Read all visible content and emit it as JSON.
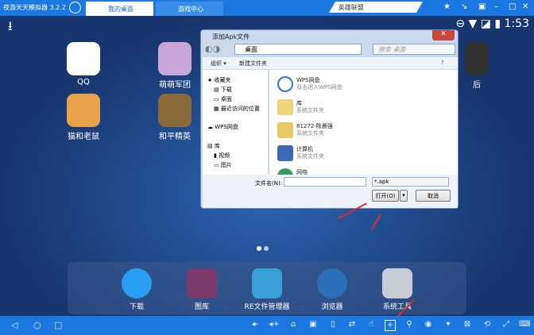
{
  "titlebar": {
    "app_name": "夜游天天模拟器 3.2.2",
    "tabs": [
      {
        "label": "我的桌面",
        "active": true
      },
      {
        "label": "游戏中心",
        "active": false
      }
    ],
    "search_value": "英雄联盟",
    "window_buttons": [
      "pin",
      "shrink",
      "restore",
      "minimize",
      "maximize",
      "close"
    ]
  },
  "statusbar": {
    "time": "1:53"
  },
  "desktop": {
    "apps": [
      {
        "label": "QQ"
      },
      {
        "label": "萌萌军团"
      },
      {
        "label": "猫和老鼠"
      },
      {
        "label": "和平精英"
      },
      {
        "label": "后"
      }
    ]
  },
  "dialog": {
    "title": "添加Apk文件",
    "close": "✕",
    "address": "桌面",
    "search_placeholder": "搜索 桌面",
    "toolbar": {
      "organize": "组织 ▾",
      "new_folder": "新建文件夹"
    },
    "nav": [
      "收藏夹",
      "下载",
      "桌面",
      "最近访问的位置",
      "WPS网盘",
      "库",
      "视频",
      "图片"
    ],
    "files": [
      {
        "name": "WPS网盘",
        "sub": "双击进入WPS网盘"
      },
      {
        "name": "库",
        "sub": "系统文件夹"
      },
      {
        "name": "81272-陈晨强",
        "sub": "系统文件夹"
      },
      {
        "name": "计算机",
        "sub": "系统文件夹"
      },
      {
        "name": "网络",
        "sub": ""
      }
    ],
    "filename_label": "文件名(N):",
    "filename_value": "",
    "filetype": "*.apk",
    "open": "打开(O)",
    "cancel": "取消"
  },
  "dock": {
    "apps": [
      {
        "label": "下载"
      },
      {
        "label": "图库"
      },
      {
        "label": "RE文件管理器"
      },
      {
        "label": "浏览器"
      },
      {
        "label": "系统工具"
      }
    ]
  },
  "colors": {
    "accent": "#1a78e0",
    "arrow": "#e02a2a"
  }
}
